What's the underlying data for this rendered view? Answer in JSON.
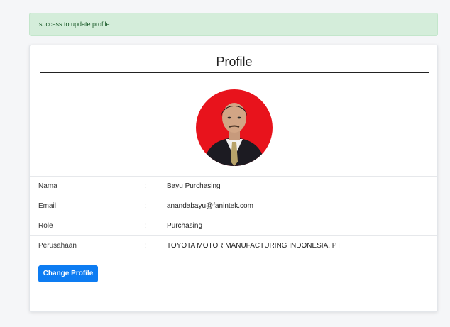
{
  "alert": {
    "message": "success to update profile"
  },
  "card": {
    "title": "Profile",
    "fields": [
      {
        "label": "Nama",
        "colon": ":",
        "value": "Bayu Purchasing"
      },
      {
        "label": "Email",
        "colon": ":",
        "value": "anandabayu@fanintek.com"
      },
      {
        "label": "Role",
        "colon": ":",
        "value": "Purchasing"
      },
      {
        "label": "Perusahaan",
        "colon": ":",
        "value": "TOYOTA MOTOR MANUFACTURING INDONESIA, PT"
      }
    ],
    "button_label": "Change Profile"
  },
  "colors": {
    "alert_bg": "#d4edda",
    "alert_text": "#155724",
    "button_bg": "#0d7cf2",
    "avatar_bg": "#e8131c"
  },
  "icons": {
    "avatar": "profile-photo"
  }
}
